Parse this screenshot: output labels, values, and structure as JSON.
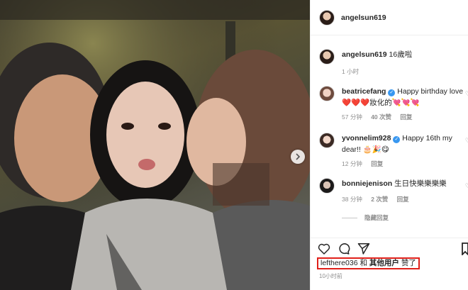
{
  "header": {
    "username": "angelsun619"
  },
  "caption": {
    "username": "angelsun619",
    "text": "16歲啦",
    "time": "1 小时"
  },
  "comments": [
    {
      "username": "beatricefang",
      "verified": true,
      "text": "Happy birthday love❤️❤️❤️妝化的💘💘💘",
      "time": "57 分钟",
      "likes": "40 次赞",
      "reply": "回复"
    },
    {
      "username": "yvonnelim928",
      "verified": true,
      "text": "Happy 16th my dear!! 🎂🎉😋",
      "time": "12 分钟",
      "reply": "回复"
    },
    {
      "username": "bonniejenison",
      "verified": false,
      "text": "生日快樂樂樂樂",
      "time": "38 分钟",
      "likes": "2 次赞",
      "reply": "回复"
    }
  ],
  "hidden_replies_label": "隐藏回复",
  "likes": {
    "user": "lefthere036",
    "and": "和",
    "others": "其他用户",
    "suffix": "赞了"
  },
  "post_time": "10小时前",
  "icons": [
    "heart-icon",
    "comment-icon",
    "share-icon",
    "bookmark-icon",
    "next-arrow-icon"
  ]
}
